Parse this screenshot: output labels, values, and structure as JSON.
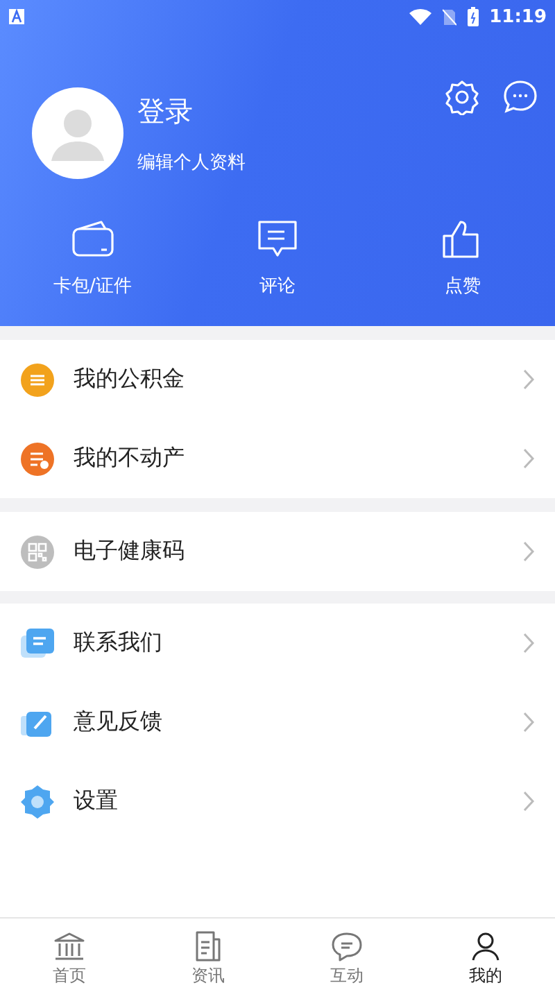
{
  "status_bar": {
    "time": "11:19"
  },
  "profile": {
    "name": "登录",
    "subtitle": "编辑个人资料"
  },
  "shortcuts": [
    {
      "kind": "wallet",
      "label": "卡包/证件"
    },
    {
      "kind": "comment",
      "label": "评论"
    },
    {
      "kind": "like",
      "label": "点赞"
    }
  ],
  "menu_groups": [
    [
      {
        "kind": "fund",
        "label": "我的公积金"
      },
      {
        "kind": "property",
        "label": "我的不动产"
      }
    ],
    [
      {
        "kind": "qrcode",
        "label": "电子健康码"
      }
    ],
    [
      {
        "kind": "contact",
        "label": "联系我们"
      },
      {
        "kind": "feedback",
        "label": "意见反馈"
      },
      {
        "kind": "settings",
        "label": "设置"
      }
    ]
  ],
  "tab_bar": [
    {
      "kind": "home",
      "label": "首页",
      "selected": false
    },
    {
      "kind": "news",
      "label": "资讯",
      "selected": false
    },
    {
      "kind": "chat",
      "label": "互动",
      "selected": false
    },
    {
      "kind": "me",
      "label": "我的",
      "selected": true
    }
  ]
}
